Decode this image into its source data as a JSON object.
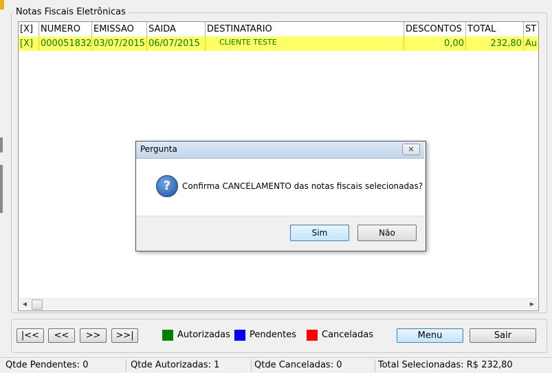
{
  "group_title": "Notas Fiscais Eletrônicas",
  "grid": {
    "columns": [
      "[X]",
      "NUMERO",
      "EMISSAO",
      "SAIDA",
      "DESTINATARIO",
      "DESCONTOS",
      "TOTAL",
      "ST"
    ],
    "rows": [
      {
        "select": "[X]",
        "numero": "000051832",
        "emissao": "03/07/2015",
        "saida": "06/07/2015",
        "destinatario": "CLIENTE TESTE",
        "descontos": "0,00",
        "total": "232,80",
        "status": "Au"
      }
    ]
  },
  "nav": {
    "first": "|<<",
    "prev": "<<",
    "next": ">>",
    "last": ">>|"
  },
  "legend": [
    {
      "label": "Autorizadas",
      "color": "#008000"
    },
    {
      "label": "Pendentes",
      "color": "#0000ff"
    },
    {
      "label": "Canceladas",
      "color": "#ff0000"
    }
  ],
  "buttons": {
    "menu": "Menu",
    "exit": "Sair"
  },
  "status_bar": {
    "pendentes": "Qtde Pendentes: 0",
    "autorizadas": "Qtde Autorizadas: 1",
    "canceladas": "Qtde Canceladas: 0",
    "total": "Total Selecionadas: R$ 232,80"
  },
  "dialog": {
    "title": "Pergunta",
    "icon": "question-icon",
    "message": "Confirma CANCELAMENTO das notas fiscais selecionadas?",
    "yes": "Sim",
    "no": "Não"
  }
}
